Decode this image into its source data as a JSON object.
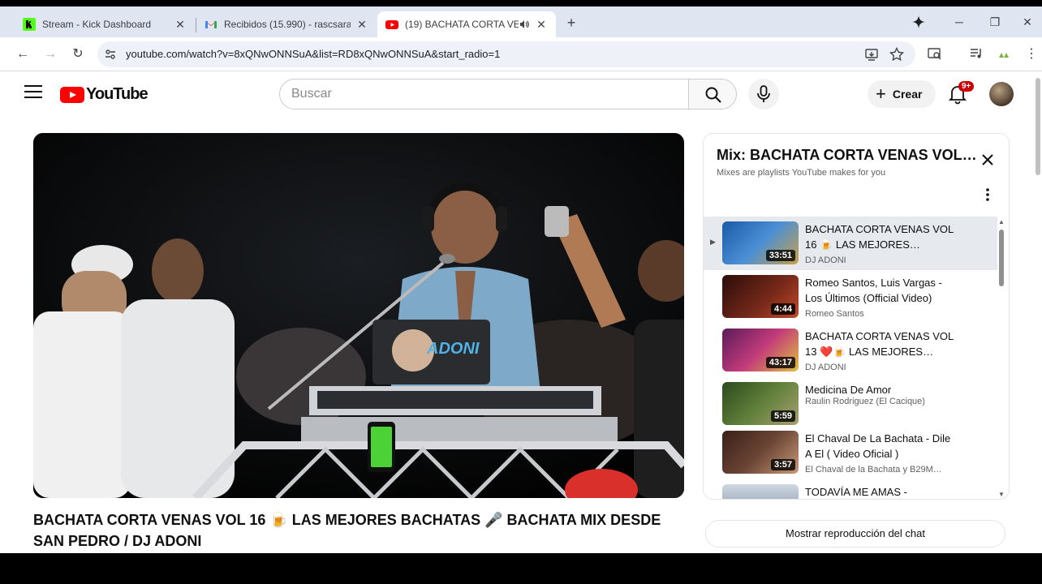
{
  "browser": {
    "tabs": [
      {
        "title": "Stream - Kick Dashboard",
        "favicon": "kick-icon",
        "active": false
      },
      {
        "title": "Recibidos (15.990) - rascsarang…",
        "favicon": "gmail-icon",
        "active": false
      },
      {
        "title": "(19) BACHATA CORTA VENA…",
        "favicon": "youtube-icon",
        "active": true,
        "audio": true
      }
    ],
    "url": "youtube.com/watch?v=8xQNwONNSuA&list=RD8xQNwONNSuA&start_radio=1"
  },
  "youtube": {
    "logo_text": "YouTube",
    "search_placeholder": "Buscar",
    "create_label": "Crear",
    "notification_badge": "9+"
  },
  "video": {
    "title": "BACHATA CORTA VENAS VOL 16 🍺 LAS MEJORES BACHATAS 🎤 BACHATA MIX DESDE SAN PEDRO / DJ ADONI",
    "overlay_text": "ADONI"
  },
  "playlist": {
    "title": "Mix: BACHATA CORTA VENAS VOL…",
    "subtitle": "Mixes are playlists YouTube makes for you",
    "items": [
      {
        "title": "BACHATA CORTA VENAS VOL 16 🍺 LAS MEJORES…",
        "channel": "DJ ADONI",
        "duration": "33:51",
        "current": true,
        "thumb": "#2f6fb8"
      },
      {
        "title": "Romeo Santos, Luis Vargas - Los Últimos (Official Video)",
        "channel": "Romeo Santos",
        "duration": "4:44",
        "current": false,
        "thumb": "#5a1a14"
      },
      {
        "title": "BACHATA CORTA VENAS VOL 13 ❤️🍺 LAS MEJORES…",
        "channel": "DJ ADONI",
        "duration": "43:17",
        "current": false,
        "thumb": "#8a2a6a"
      },
      {
        "title": "Medicina De Amor",
        "channel": "Raulin Rodriguez (El Cacique)",
        "duration": "5:59",
        "current": false,
        "thumb": "#3c5a2a"
      },
      {
        "title": "El Chaval De La Bachata - Dile A El ( Video Oficial )",
        "channel": "El Chaval de la Bachata y B29M…",
        "duration": "3:57",
        "current": false,
        "thumb": "#4a2c22"
      },
      {
        "title": "TODAVÍA ME AMAS - AVENTURA / INTRO",
        "channel": "",
        "duration": "",
        "current": false,
        "thumb": "#8ea6bf"
      }
    ]
  },
  "chat_button": "Mostrar reproducción del chat"
}
